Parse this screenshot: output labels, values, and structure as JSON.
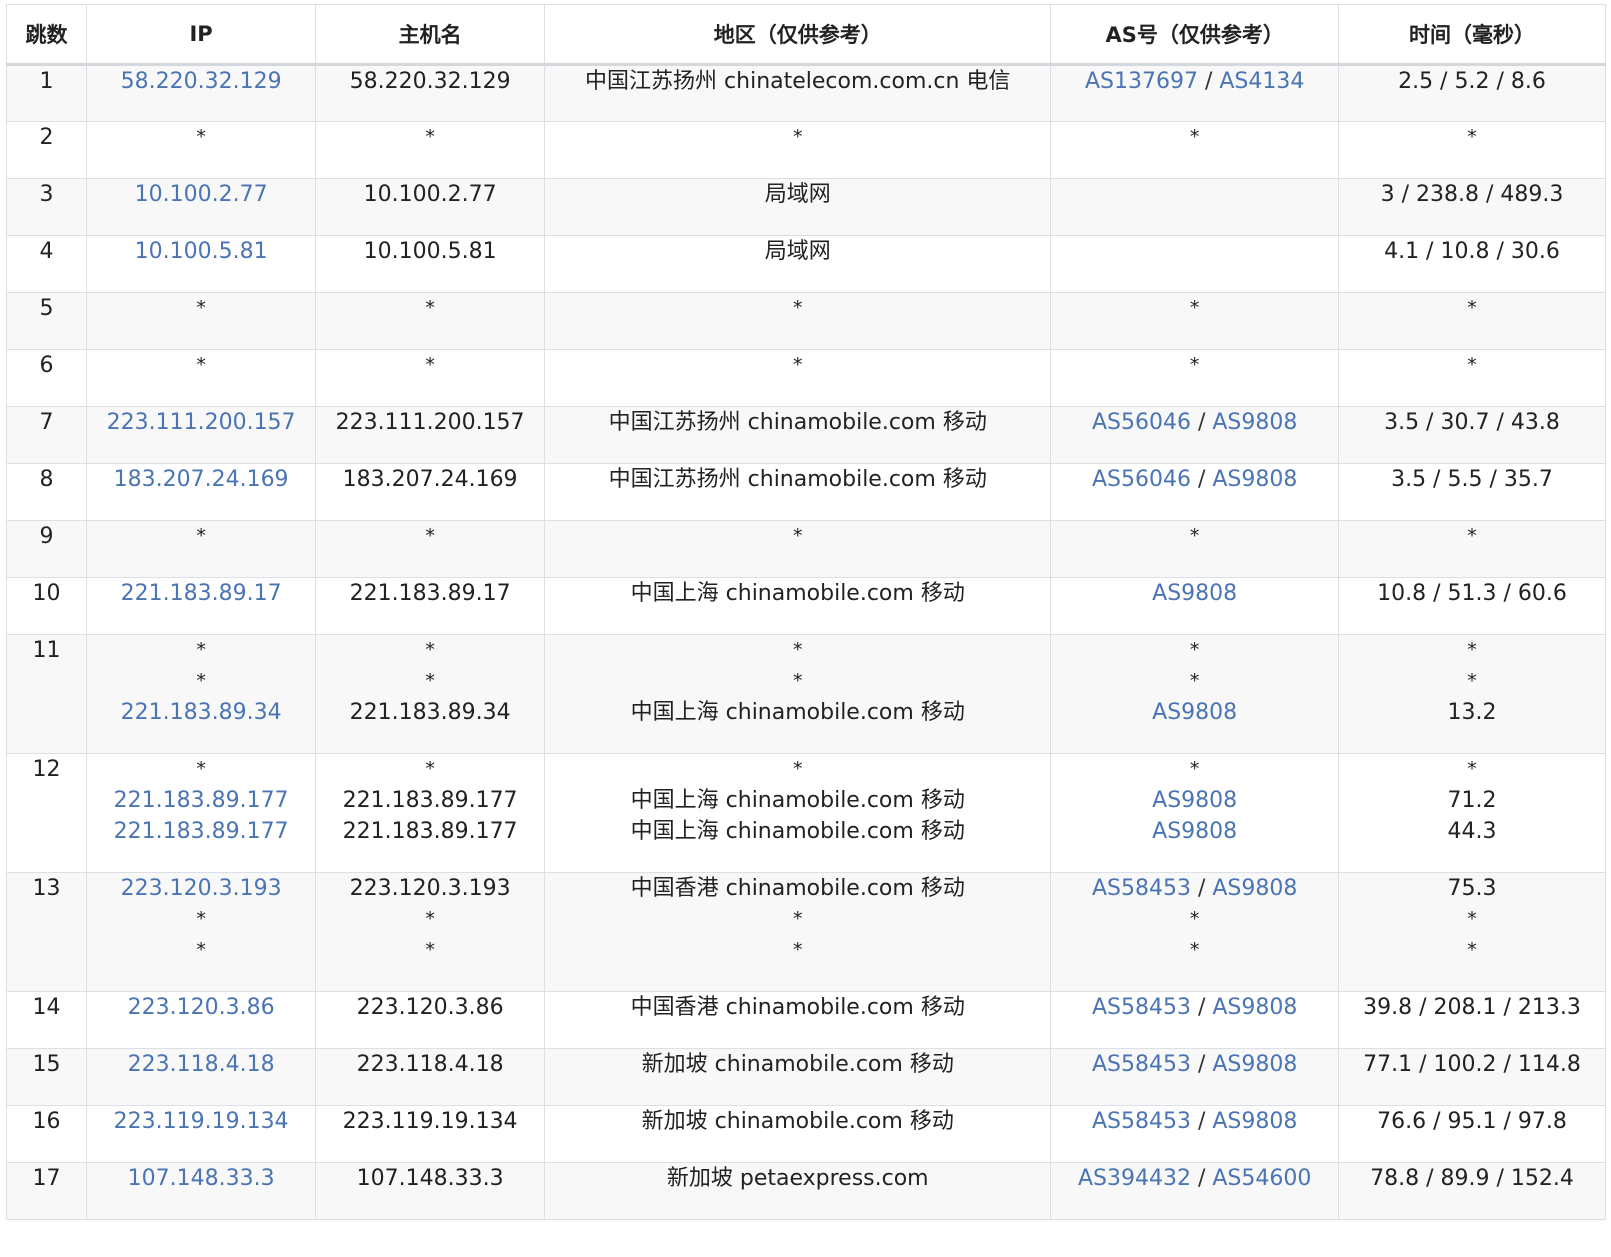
{
  "headers": [
    "跳数",
    "IP",
    "主机名",
    "地区（仅供参考）",
    "AS号（仅供参考）",
    "时间（毫秒）"
  ],
  "rows": [
    {
      "hop": "1",
      "ip": [
        "58.220.32.129"
      ],
      "host": [
        "58.220.32.129"
      ],
      "region": [
        "中国江苏扬州 chinatelecom.com.cn 电信"
      ],
      "as": [
        [
          "AS137697",
          "AS4134"
        ]
      ],
      "time": [
        "2.5 / 5.2 / 8.6"
      ]
    },
    {
      "hop": "2",
      "ip": [
        "*"
      ],
      "host": [
        "*"
      ],
      "region": [
        "*"
      ],
      "as": [
        "*"
      ],
      "time": [
        "*"
      ]
    },
    {
      "hop": "3",
      "ip": [
        "10.100.2.77"
      ],
      "host": [
        "10.100.2.77"
      ],
      "region": [
        "局域网"
      ],
      "as": [
        ""
      ],
      "time": [
        "3 / 238.8 / 489.3"
      ]
    },
    {
      "hop": "4",
      "ip": [
        "10.100.5.81"
      ],
      "host": [
        "10.100.5.81"
      ],
      "region": [
        "局域网"
      ],
      "as": [
        ""
      ],
      "time": [
        "4.1 / 10.8 / 30.6"
      ]
    },
    {
      "hop": "5",
      "ip": [
        "*"
      ],
      "host": [
        "*"
      ],
      "region": [
        "*"
      ],
      "as": [
        "*"
      ],
      "time": [
        "*"
      ]
    },
    {
      "hop": "6",
      "ip": [
        "*"
      ],
      "host": [
        "*"
      ],
      "region": [
        "*"
      ],
      "as": [
        "*"
      ],
      "time": [
        "*"
      ]
    },
    {
      "hop": "7",
      "ip": [
        "223.111.200.157"
      ],
      "host": [
        "223.111.200.157"
      ],
      "region": [
        "中国江苏扬州 chinamobile.com 移动"
      ],
      "as": [
        [
          "AS56046",
          "AS9808"
        ]
      ],
      "time": [
        "3.5 / 30.7 / 43.8"
      ]
    },
    {
      "hop": "8",
      "ip": [
        "183.207.24.169"
      ],
      "host": [
        "183.207.24.169"
      ],
      "region": [
        "中国江苏扬州 chinamobile.com 移动"
      ],
      "as": [
        [
          "AS56046",
          "AS9808"
        ]
      ],
      "time": [
        "3.5 / 5.5 / 35.7"
      ]
    },
    {
      "hop": "9",
      "ip": [
        "*"
      ],
      "host": [
        "*"
      ],
      "region": [
        "*"
      ],
      "as": [
        "*"
      ],
      "time": [
        "*"
      ]
    },
    {
      "hop": "10",
      "ip": [
        "221.183.89.17"
      ],
      "host": [
        "221.183.89.17"
      ],
      "region": [
        "中国上海 chinamobile.com 移动"
      ],
      "as": [
        [
          "AS9808"
        ]
      ],
      "time": [
        "10.8 / 51.3 / 60.6"
      ]
    },
    {
      "hop": "11",
      "ip": [
        "*",
        "*",
        "221.183.89.34"
      ],
      "host": [
        "*",
        "*",
        "221.183.89.34"
      ],
      "region": [
        "*",
        "*",
        "中国上海 chinamobile.com 移动"
      ],
      "as": [
        "*",
        "*",
        [
          "AS9808"
        ]
      ],
      "time": [
        "*",
        "*",
        "13.2"
      ]
    },
    {
      "hop": "12",
      "ip": [
        "*",
        "221.183.89.177",
        "221.183.89.177"
      ],
      "host": [
        "*",
        "221.183.89.177",
        "221.183.89.177"
      ],
      "region": [
        "*",
        "中国上海 chinamobile.com 移动",
        "中国上海 chinamobile.com 移动"
      ],
      "as": [
        "*",
        [
          "AS9808"
        ],
        [
          "AS9808"
        ]
      ],
      "time": [
        "*",
        "71.2",
        "44.3"
      ]
    },
    {
      "hop": "13",
      "ip": [
        "223.120.3.193",
        "*",
        "*"
      ],
      "host": [
        "223.120.3.193",
        "*",
        "*"
      ],
      "region": [
        "中国香港 chinamobile.com 移动",
        "*",
        "*"
      ],
      "as": [
        [
          "AS58453",
          "AS9808"
        ],
        "*",
        "*"
      ],
      "time": [
        "75.3",
        "*",
        "*"
      ]
    },
    {
      "hop": "14",
      "ip": [
        "223.120.3.86"
      ],
      "host": [
        "223.120.3.86"
      ],
      "region": [
        "中国香港 chinamobile.com 移动"
      ],
      "as": [
        [
          "AS58453",
          "AS9808"
        ]
      ],
      "time": [
        "39.8 / 208.1 / 213.3"
      ]
    },
    {
      "hop": "15",
      "ip": [
        "223.118.4.18"
      ],
      "host": [
        "223.118.4.18"
      ],
      "region": [
        "新加坡 chinamobile.com 移动"
      ],
      "as": [
        [
          "AS58453",
          "AS9808"
        ]
      ],
      "time": [
        "77.1 / 100.2 / 114.8"
      ]
    },
    {
      "hop": "16",
      "ip": [
        "223.119.19.134"
      ],
      "host": [
        "223.119.19.134"
      ],
      "region": [
        "新加坡 chinamobile.com 移动"
      ],
      "as": [
        [
          "AS58453",
          "AS9808"
        ]
      ],
      "time": [
        "76.6 / 95.1 / 97.8"
      ]
    },
    {
      "hop": "17",
      "ip": [
        "107.148.33.3"
      ],
      "host": [
        "107.148.33.3"
      ],
      "region": [
        "新加坡 petaexpress.com"
      ],
      "as": [
        [
          "AS394432",
          "AS54600"
        ]
      ],
      "time": [
        "78.8 / 89.9 / 152.4"
      ]
    }
  ]
}
